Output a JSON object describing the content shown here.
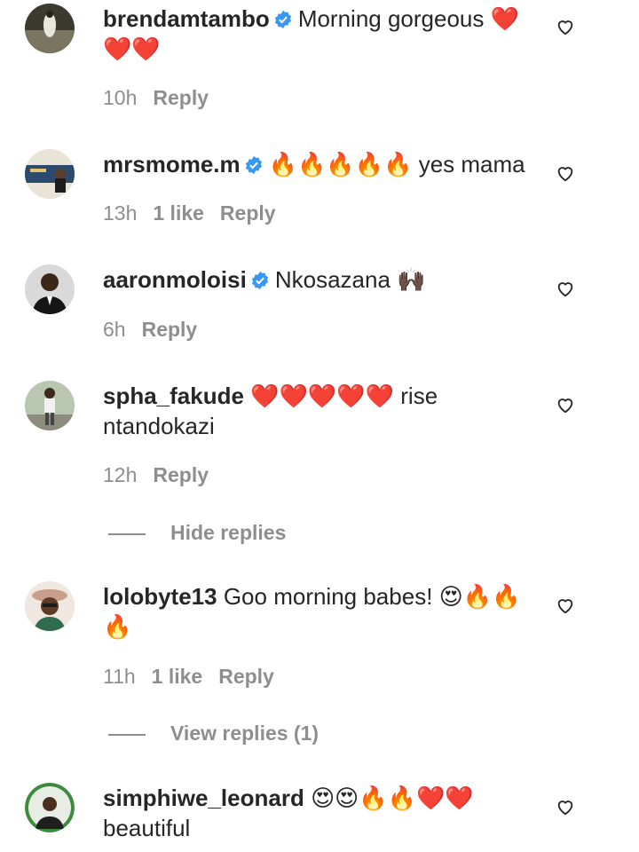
{
  "comments": [
    {
      "username": "brendamtambo",
      "verified": true,
      "text": "Morning gorgeous ❤️❤️❤️",
      "time": "10h",
      "likes": "",
      "reply_label": "Reply"
    },
    {
      "username": "mrsmome.m",
      "verified": true,
      "text": "🔥🔥🔥🔥🔥 yes mama",
      "time": "13h",
      "likes": "1 like",
      "reply_label": "Reply"
    },
    {
      "username": "aaronmoloisi",
      "verified": true,
      "text": "Nkosazana 🙌🏿",
      "time": "6h",
      "likes": "",
      "reply_label": "Reply"
    },
    {
      "username": "spha_fakude",
      "verified": false,
      "text": "❤️❤️❤️❤️❤️ rise ntandokazi",
      "time": "12h",
      "likes": "",
      "reply_label": "Reply"
    },
    {
      "username": "lolobyte13",
      "verified": false,
      "text": "Goo morning babes! 😍🔥🔥🔥",
      "time": "11h",
      "likes": "1 like",
      "reply_label": "Reply"
    },
    {
      "username": "simphiwe_leonard",
      "verified": false,
      "text": "😍😍🔥🔥❤️❤️ beautiful",
      "time": "",
      "likes": "",
      "reply_label": ""
    }
  ],
  "thread_toggles": {
    "hide_replies": "Hide replies",
    "view_replies": "View replies (1)"
  },
  "colors": {
    "text": "#262626",
    "secondary": "#8e8e8e",
    "verified_badge": "#3897f0",
    "background": "#ffffff"
  },
  "icons": {
    "verified": "verified-badge-icon",
    "like": "heart-outline-icon"
  }
}
